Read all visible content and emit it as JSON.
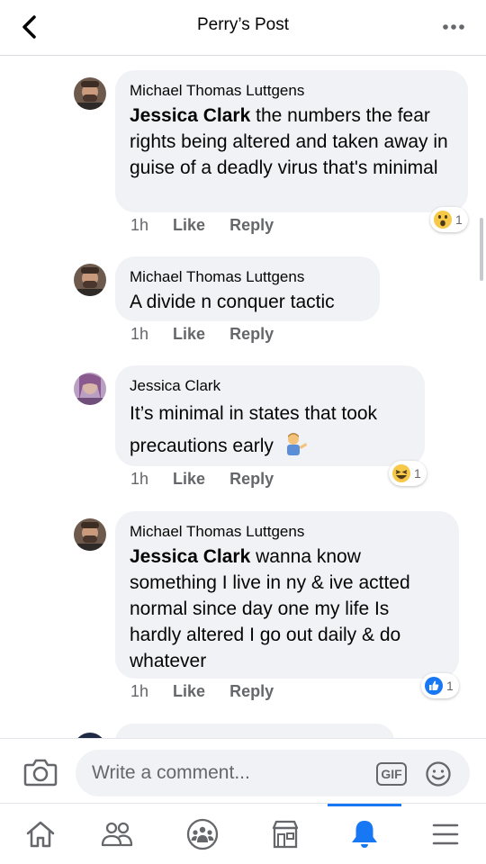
{
  "header": {
    "title": "Perry’s Post"
  },
  "comments": [
    {
      "author": "Michael Thomas Luttgens",
      "tag": "Jessica Clark",
      "text": " the numbers the fear rights being altered and taken away in guise of a deadly virus that's minimal",
      "time": "1h",
      "like": "Like",
      "reply": "Reply",
      "reaction_icon": "wow-emoji",
      "reaction_count": "1"
    },
    {
      "author": "Michael Thomas Luttgens",
      "tag": "",
      "text": "A divide n conquer tactic",
      "time": "1h",
      "like": "Like",
      "reply": "Reply"
    },
    {
      "author": "Jessica Clark",
      "tag": "",
      "text": "It’s minimal in states that took precautions early",
      "text_emoji": "man-tipping-hand-emoji",
      "time": "1h",
      "like": "Like",
      "reply": "Reply",
      "reaction_icon": "haha-emoji",
      "reaction_count": "1"
    },
    {
      "author": "Michael Thomas Luttgens",
      "tag": "Jessica Clark",
      "text": " wanna know something I live in ny & ive actted normal since day one my life Is hardly altered I go out daily & do whatever",
      "time": "1h",
      "like": "Like",
      "reply": "Reply",
      "reaction_icon": "like-thumb-icon",
      "reaction_count": "1"
    }
  ],
  "composer": {
    "placeholder": "Write a comment...",
    "gif_label": "GIF"
  },
  "tabbar": {
    "items": [
      "home-icon",
      "friends-icon",
      "groups-icon",
      "marketplace-icon",
      "notifications-bell-icon",
      "menu-icon"
    ],
    "active": "notifications-bell-icon"
  },
  "colors": {
    "accent": "#1877f2",
    "bubble": "#f0f2f5",
    "meta": "#65676b"
  }
}
